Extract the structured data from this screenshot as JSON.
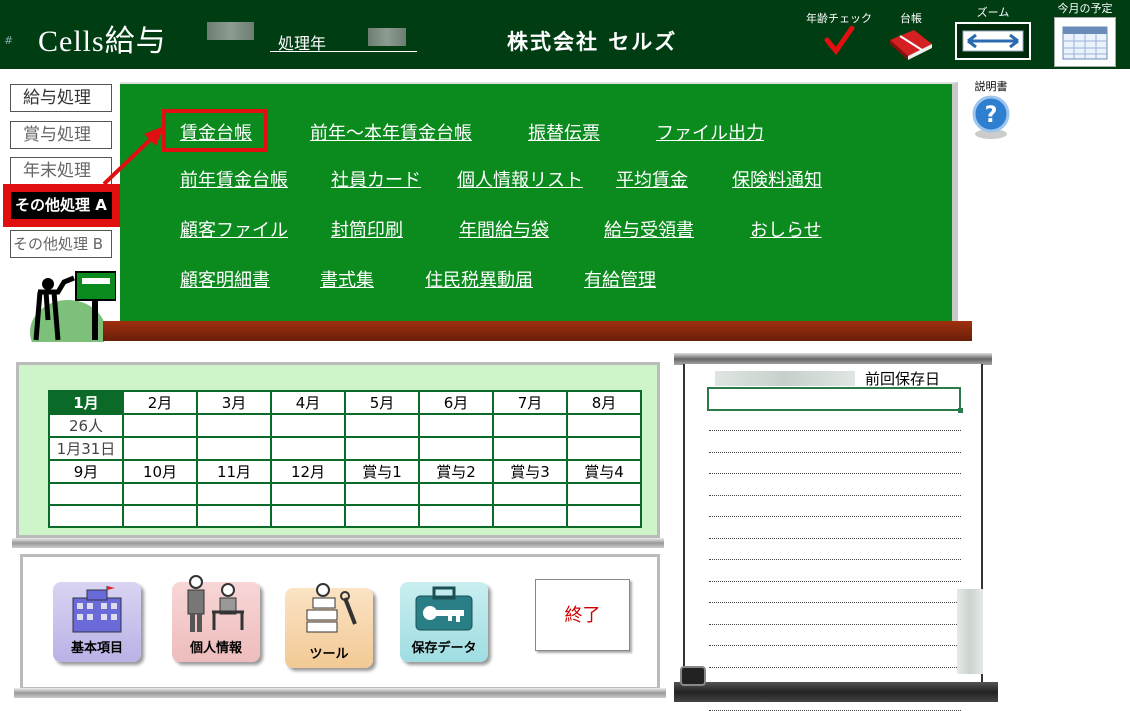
{
  "header": {
    "hash": "#",
    "title": "Cells給与",
    "year_label": "処理年",
    "company": "株式会社 セルズ",
    "tools": [
      {
        "label": "年齢チェック",
        "icon": "check-icon"
      },
      {
        "label": "台帳",
        "icon": "ledger-book-icon"
      },
      {
        "label": "ズーム",
        "icon": "zoom-arrows-icon"
      },
      {
        "label": "今月の予定",
        "icon": "calendar-icon"
      }
    ],
    "manual_label": "説明書"
  },
  "sidebar": {
    "items": [
      {
        "label": "給与処理",
        "active": false
      },
      {
        "label": "賞与処理",
        "active": false
      },
      {
        "label": "年末処理",
        "active": false
      },
      {
        "label": "その他処理 A",
        "active": true
      },
      {
        "label": "その他処理 B",
        "active": false
      }
    ]
  },
  "menu": {
    "rows": [
      [
        "賃金台帳",
        "前年～本年賃金台帳",
        "振替伝票",
        "ファイル出力"
      ],
      [
        "前年賃金台帳",
        "社員カード",
        "個人情報リスト",
        "平均賃金",
        "保険料通知"
      ],
      [
        "顧客ファイル",
        "封筒印刷",
        "年間給与袋",
        "給与受領書",
        "おしらせ"
      ],
      [
        "顧客明細書",
        "書式集",
        "住民税異動届",
        "有給管理"
      ]
    ],
    "highlighted": "賃金台帳"
  },
  "calendar": {
    "months_top": [
      "1月",
      "2月",
      "3月",
      "4月",
      "5月",
      "6月",
      "7月",
      "8月"
    ],
    "row_headcount": [
      "26人",
      "",
      "",
      "",
      "",
      "",
      "",
      ""
    ],
    "row_date": [
      "1月31日",
      "",
      "",
      "",
      "",
      "",
      "",
      ""
    ],
    "months_bottom": [
      "9月",
      "10月",
      "11月",
      "12月",
      "賞与1",
      "賞与2",
      "賞与3",
      "賞与4"
    ],
    "empty_rows": 2
  },
  "tools": {
    "buttons": [
      {
        "label": "基本項目",
        "icon": "building-icon"
      },
      {
        "label": "個人情報",
        "icon": "people-icon"
      },
      {
        "label": "ツール",
        "icon": "tools-icon"
      },
      {
        "label": "保存データ",
        "icon": "key-case-icon"
      }
    ],
    "exit_label": "終了"
  },
  "notes": {
    "saved_label": "前回保存日",
    "line_count": 14
  },
  "colors": {
    "header_bg": "#003d13",
    "board_green": "#0b8a1e",
    "calendar_bg": "#cdf5c9",
    "highlight_red": "#e01010"
  }
}
